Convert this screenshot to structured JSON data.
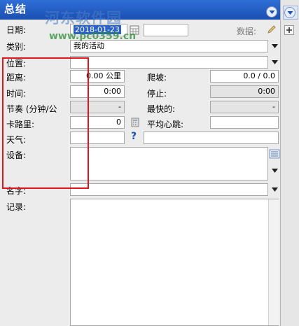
{
  "panel": {
    "title": "总结"
  },
  "watermark": {
    "line1": "河东软件园",
    "line2": "www.pc0359.cn"
  },
  "fields": {
    "date": {
      "label": "日期:",
      "value": "2018-01-23"
    },
    "data_label": "数据:",
    "category": {
      "label": "类别:",
      "value": "我的活动"
    },
    "location": {
      "label": "位置:",
      "value": ""
    },
    "distance": {
      "label": "距离:",
      "value": "0.00",
      "unit": "公里"
    },
    "climb": {
      "label": "爬坡:",
      "value": "0.0 / 0.0"
    },
    "time": {
      "label": "时间:",
      "value": "0:00"
    },
    "stop": {
      "label": "停止:",
      "value": "0:00"
    },
    "pace": {
      "label": "节奏 (分钟/公",
      "value": "-"
    },
    "fastest": {
      "label": "最快的:",
      "value": "-"
    },
    "calories": {
      "label": "卡路里:",
      "value": "0"
    },
    "avg_hr": {
      "label": "平均心跳:",
      "value": ""
    },
    "weather": {
      "label": "天气:",
      "value": "",
      "help": "?"
    },
    "equipment": {
      "label": "设备:",
      "value": ""
    },
    "name": {
      "label": "名字:",
      "value": ""
    },
    "notes": {
      "label": "记录:",
      "value": ""
    }
  },
  "colors": {
    "header": "#1b4fb0",
    "highlight": "#e0151d"
  },
  "icons": [
    "chevron-down-icon",
    "calendar-icon",
    "pencil-icon",
    "calculator-icon",
    "help-icon",
    "list-icon",
    "add-icon"
  ]
}
